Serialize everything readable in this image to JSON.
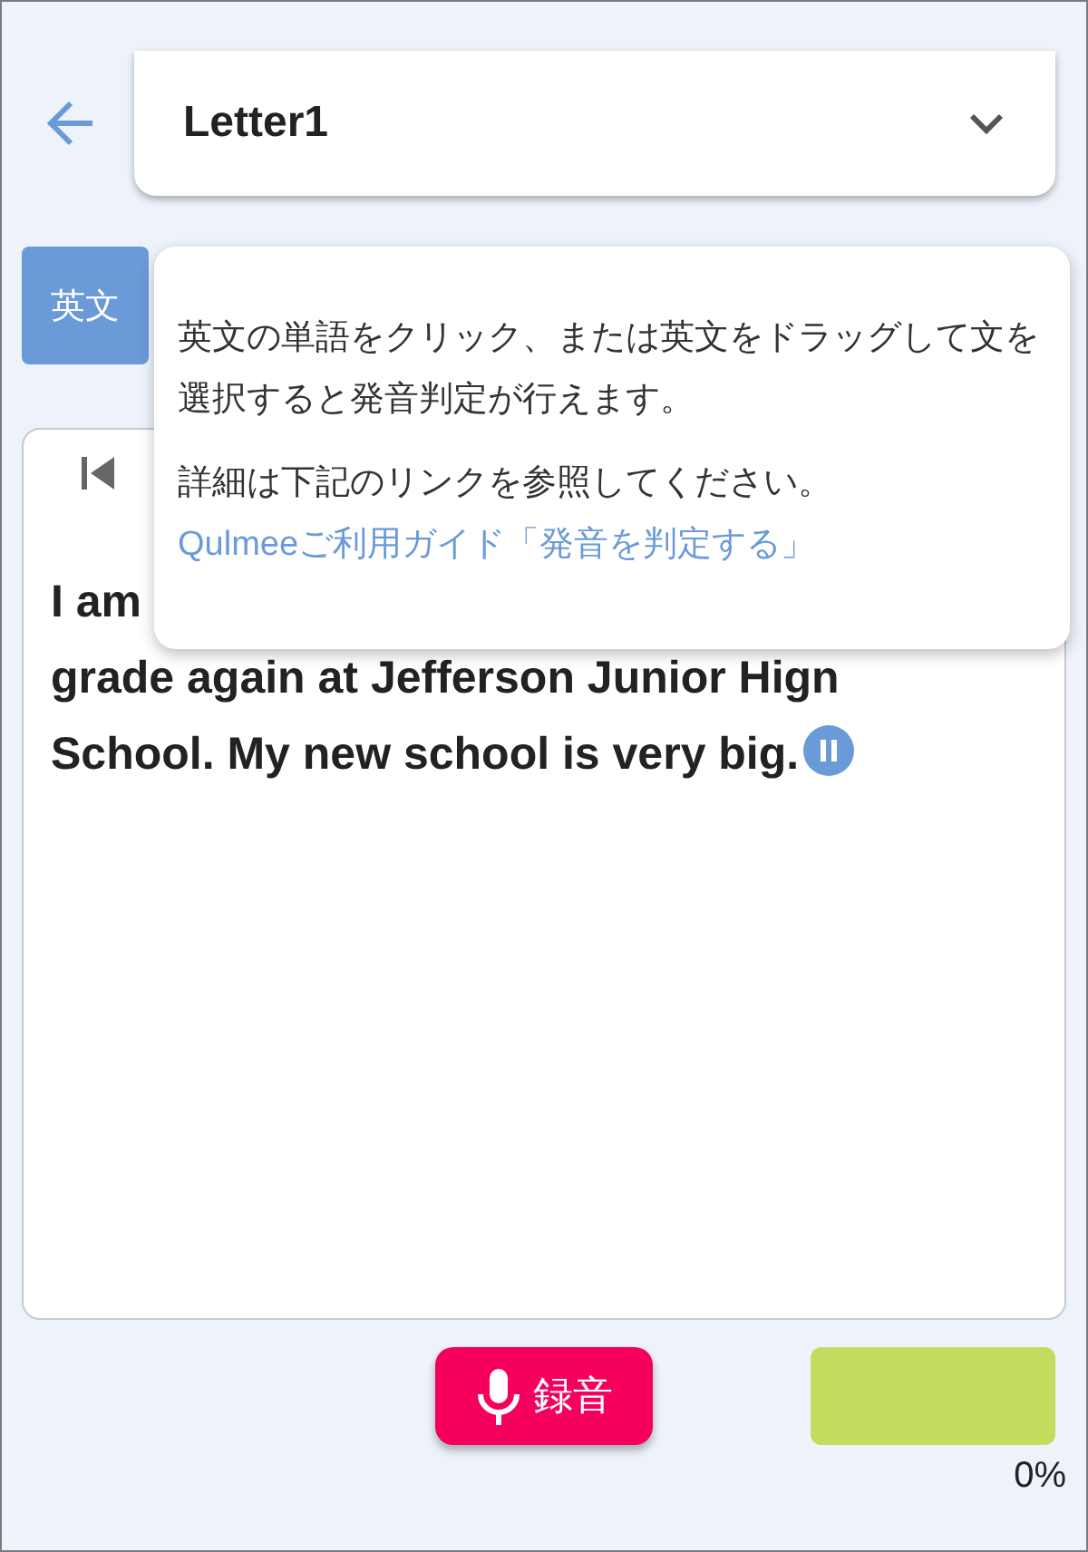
{
  "header": {
    "document": "Letter1"
  },
  "tabs": [
    {
      "label": "英文",
      "selected": true
    }
  ],
  "passage": {
    "lines": [
      "I am",
      "grade again at Jefferson Junior Hign",
      "School. My new school is very big."
    ],
    "playing": true
  },
  "popover": {
    "paragraphs": [
      "英文の単語をクリック、または英文をドラッグして文を選択すると発音判定が行えます。",
      "詳細は下記のリンクを参照してください。"
    ],
    "link": "Qulmeeご利用ガイド「発音を判定する」"
  },
  "record_button": {
    "label": "録音"
  },
  "score": {
    "reading": "0%"
  }
}
